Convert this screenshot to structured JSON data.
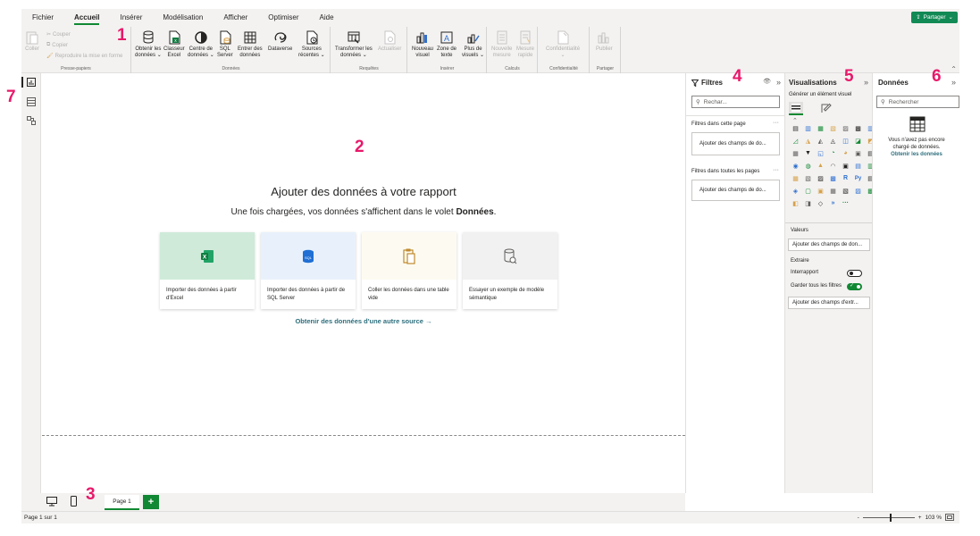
{
  "menu": {
    "items": [
      "Fichier",
      "Accueil",
      "Insérer",
      "Modélisation",
      "Afficher",
      "Optimiser",
      "Aide"
    ],
    "active": "Accueil",
    "share_label": "Partager"
  },
  "ribbon": {
    "clipboard": {
      "paste": "Coller",
      "cut": "Couper",
      "copy": "Copier",
      "format_painter": "Reproduire la mise en forme",
      "group_label": "Presse-papiers"
    },
    "data": {
      "get_data": [
        "Obtenir les",
        "données ⌄"
      ],
      "excel": [
        "Classeur",
        "Excel"
      ],
      "hub": [
        "Centre de",
        "données ⌄"
      ],
      "sql": [
        "SQL",
        "Server"
      ],
      "enter": [
        "Entrer des",
        "données"
      ],
      "dataverse": [
        "Dataverse",
        ""
      ],
      "recent": [
        "Sources",
        "récentes ⌄"
      ],
      "group_label": "Données"
    },
    "queries": {
      "transform": [
        "Transformer les",
        "données ⌄"
      ],
      "refresh": [
        "Actualiser",
        ""
      ],
      "group_label": "Requêtes"
    },
    "insert": {
      "new_visual": [
        "Nouveau",
        "visuel"
      ],
      "text_box": [
        "Zone de",
        "texte"
      ],
      "more_visuals": [
        "Plus de",
        "visuels ⌄"
      ],
      "group_label": "Insérer"
    },
    "calculations": {
      "new_measure": [
        "Nouvelle",
        "mesure"
      ],
      "quick_measure": [
        "Mesure",
        "rapide"
      ],
      "group_label": "Calculs"
    },
    "sensitivity": {
      "label": [
        "Confidentialité",
        "⌄"
      ],
      "group_label": "Confidentialité"
    },
    "share": {
      "publish": [
        "Publier",
        ""
      ],
      "group_label": "Partager"
    }
  },
  "canvas": {
    "title": "Ajouter des données à votre rapport",
    "subtitle_prefix": "Une fois chargées, vos données s'affichent dans le volet ",
    "subtitle_bold": "Données",
    "subtitle_suffix": ".",
    "cards": [
      {
        "text": "Importer des données à partir d'Excel",
        "bg": "#cfead9"
      },
      {
        "text": "Importer des données à partir de SQL Server",
        "bg": "#e8f1fb"
      },
      {
        "text": "Coller les données dans une table vide",
        "bg": "#fdfbf1"
      },
      {
        "text": "Essayer un exemple de modèle sémantique",
        "bg": "#f1f1f1"
      }
    ],
    "other_source": "Obtenir des données d'une autre source →"
  },
  "filters": {
    "title": "Filtres",
    "search_placeholder": "Rechar...",
    "this_page": "Filtres dans cette page",
    "this_page_well": "Ajouter des champs de do...",
    "all_pages": "Filtres dans toutes les pages",
    "all_pages_well": "Ajouter des champs de do..."
  },
  "visualizations": {
    "title": "Visualisations",
    "build": "Générer un élément visuel",
    "values_label": "Valeurs",
    "values_well": "Ajouter des champs de don...",
    "drill_label": "Extraire",
    "cross_report": "Interrapport",
    "cross_report_state": "Désactivé",
    "keep_filters": "Garder tous les filtres",
    "keep_filters_state": "Activé",
    "drill_well": "Ajouter des champs d'extr..."
  },
  "data_pane": {
    "title": "Données",
    "search_placeholder": "Rechercher",
    "empty_text": "Vous n'avez pas encore chargé de données.",
    "get_data_link": "Obtenir les données"
  },
  "pages": {
    "tab": "Page 1",
    "add": "+"
  },
  "status": {
    "page_info": "Page 1 sur 1",
    "zoom_minus": "-",
    "zoom_plus": "+",
    "zoom_level": "103 %"
  },
  "callouts": [
    "1",
    "2",
    "3",
    "4",
    "5",
    "6",
    "7"
  ],
  "colors": {
    "accent": "#118833",
    "share": "#128a55",
    "callout": "#e8196a",
    "link": "#2d6f7d"
  }
}
